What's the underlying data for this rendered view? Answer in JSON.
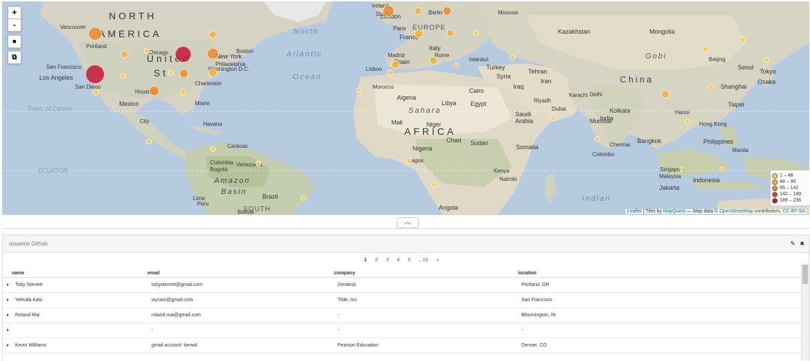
{
  "map": {
    "zoom_in": "+",
    "zoom_out": "-",
    "tool_rect": "■",
    "tool_crop": "⧉",
    "labels": {
      "north": "NORTH",
      "america": "AMERICA",
      "united": "United",
      "states": "St",
      "africa": "AFRICA",
      "europe": "EUROPE",
      "china": "China",
      "gobi": "Gobi",
      "sahara": "Sahara",
      "north_atlantic": "North",
      "atlantic": "Atlantic",
      "ocean": "Ocean",
      "indian": "Indian",
      "amazon": "Amazon",
      "basin": "Basin",
      "south": "SOUTH",
      "tropic": "Tropic of Cancer",
      "ecuator": "ECUATOR",
      "kazakhstan": "Kazakhstan",
      "mongolia": "Mongolia",
      "brazil": "Brazil",
      "peru": "Peru",
      "bolivia": "Bolivia",
      "colombia": "Colombia",
      "venezuela": "Venezuela",
      "mexico": "Mexico",
      "mexico_city": "City",
      "algeria": "Algeria",
      "libya": "Libya",
      "egypt": "Egypt",
      "niger": "Niger",
      "mali": "Mali",
      "chad": "Chad",
      "sudan": "Sudan",
      "nigeria": "Nigeria",
      "angola": "Angola",
      "somalia": "Somalia",
      "kenya": "Kenya",
      "iran": "Iran",
      "iraq": "Iraq",
      "saudi": "Saudi",
      "arabia": "Arabia",
      "india": "India",
      "turkey": "Turkey",
      "syria": "Syria",
      "indonesia": "Indonesia",
      "philippines": "Philippines",
      "malaysia": "Malaysia",
      "san_francisco": "San Francisco",
      "los_angeles": "Los Angeles",
      "san_diego": "San Diego",
      "chicago": "Chicago",
      "new_york": "New York",
      "philadelphia": "Philadelphia",
      "washington": "Washington D.C.",
      "boston": "Boston",
      "houston": "Houston",
      "miami": "Miami",
      "portland": "Portland",
      "vancouver": "Vancouver",
      "london": "London",
      "paris": "Paris",
      "berlin": "Berlin",
      "madrid": "Madrid",
      "rome": "Rome",
      "cairo": "Cairo",
      "moscow": "Moscow",
      "tehran": "Tehran",
      "mumbai": "Mumbai",
      "delhi": "Delhi",
      "beijing": "Beijing",
      "shanghai": "Shanghai",
      "tokyo": "Tokyo",
      "seoul": "Seoul",
      "osaka": "Osaka",
      "bangkok": "Bangkok",
      "jakarta": "Jakarta",
      "lagos": "Lagos",
      "nairobi": "Nairobi",
      "lima": "Lima",
      "bogota": "Bogotá",
      "caracas": "Caracas",
      "havana": "Havana",
      "taipei": "Taipei",
      "kolkata": "Kolkata",
      "karachi": "Karachi",
      "istanbul": "Istanbul",
      "dubai": "Dubai",
      "riyadh": "Riyadh",
      "dublin": "Dublin",
      "ireland": "Ireland",
      "italy": "Italy",
      "france": "France",
      "spain": "Spain",
      "lisbon": "Lisbon",
      "morocco": "Morocco",
      "singapore": "Singapore",
      "hong_kong": "Hong Kong",
      "hanoi": "Hanoi",
      "manila": "Manila",
      "chennai": "Chennai",
      "colombo": "Colombo",
      "philadelphia_2": "Charleston"
    },
    "legend": [
      {
        "label": "1 – 48",
        "color": "#f5d04a"
      },
      {
        "label": "48 – 95",
        "color": "#f4b032"
      },
      {
        "label": "95 – 142",
        "color": "#ec8a2b"
      },
      {
        "label": "142 – 189",
        "color": "#d8442e"
      },
      {
        "label": "189 – 236",
        "color": "#b5153a"
      }
    ],
    "attribution": {
      "leaflet": "Leaflet",
      "tiles_by": "| Tiles by",
      "mapquest": "MapQuest",
      "map_data": "— Map data ©",
      "osm": "OpenStreetMap",
      "contributors": "contributors,",
      "license": "CC-BY-SA"
    }
  },
  "collapse_icon": "︿",
  "panel": {
    "title": "usuarios Github",
    "edit_icon": "✎",
    "close_icon": "✖"
  },
  "pager": {
    "pages": [
      "1",
      "2",
      "3",
      "4",
      "5",
      "...10",
      "»"
    ],
    "current": "1"
  },
  "table": {
    "columns": [
      "name",
      "email",
      "company",
      "location"
    ],
    "rows": [
      {
        "name": "Toby Sterrett",
        "email": "tobysterrett@gmail.com",
        "company": "Zendesk",
        "location": "Portland, OR"
      },
      {
        "name": "Yehuda Katz",
        "email": "wycats@gmail.com",
        "company": "Tilde, Inc.",
        "location": "San Francisco"
      },
      {
        "name": "Roland Mai",
        "email": "roland.mai@gmail.com",
        "company": "-",
        "location": "Bloomington, IN"
      },
      {
        "name": "",
        "email": "-",
        "company": "-",
        "location": "-"
      },
      {
        "name": "Kevin Williams",
        "email": "gmail account: kevwil",
        "company": "Pearson Education",
        "location": "Denver, CO"
      }
    ]
  }
}
